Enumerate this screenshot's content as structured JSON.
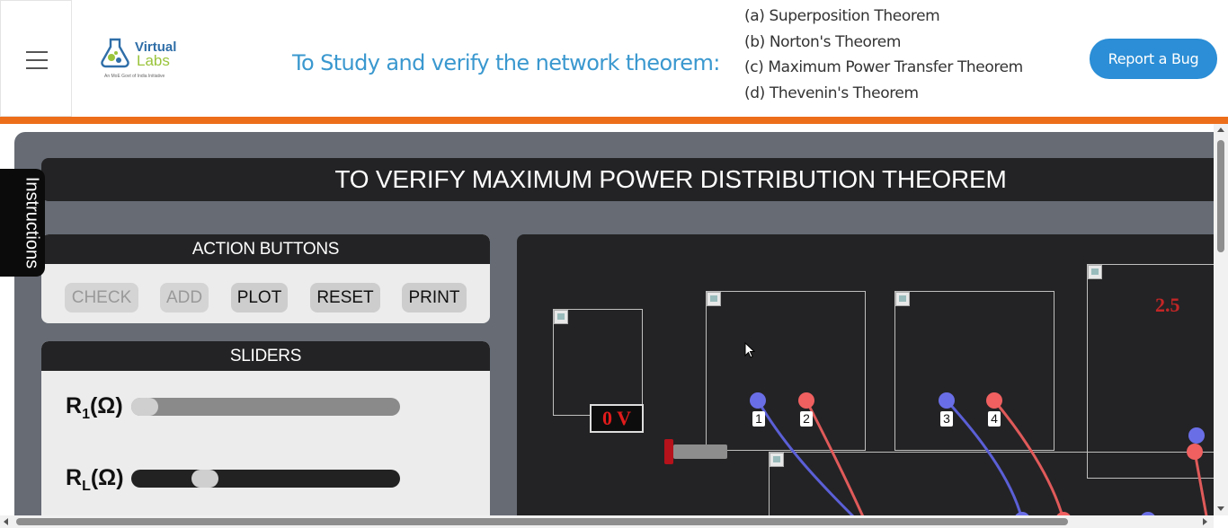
{
  "header": {
    "logo": {
      "word1": "Virtual",
      "word2": "Labs",
      "tagline": "An MoE Govt of India Initiative"
    },
    "title": "To Study and verify the network theorem:",
    "theorems": [
      "(a) Superposition Theorem",
      "(b) Norton's Theorem",
      "(c) Maximum Power Transfer Theorem",
      "(d) Thevenin's Theorem"
    ],
    "report_bug": "Report a Bug"
  },
  "sidebar_tab": {
    "label": "Instructions"
  },
  "simulation": {
    "title": "TO VERIFY MAXIMUM POWER DISTRIBUTION THEOREM",
    "action_panel": {
      "heading": "ACTION BUTTONS",
      "buttons": [
        {
          "label": "CHECK",
          "enabled": false
        },
        {
          "label": "ADD",
          "enabled": false
        },
        {
          "label": "PLOT",
          "enabled": true
        },
        {
          "label": "RESET",
          "enabled": true
        },
        {
          "label": "PRINT",
          "enabled": true
        }
      ]
    },
    "sliders_panel": {
      "heading": "SLIDERS",
      "sliders": [
        {
          "label_main": "R",
          "label_sub": "1",
          "label_unit": "(Ω)",
          "level": 0.0
        },
        {
          "label_main": "R",
          "label_sub": "L",
          "label_unit": "(Ω)",
          "level": 0.25
        }
      ]
    },
    "circuit": {
      "voltmeter_reading": "0 V",
      "meter_reading": "2.5",
      "terminals": [
        "1",
        "2",
        "3",
        "4"
      ]
    }
  },
  "colors": {
    "accent_blue": "#2b8ed6",
    "title_blue": "#3a98cf",
    "orange_bar": "#ed6e1a",
    "panel_dark": "#232325",
    "wire_blue": "#5b5fd6",
    "wire_red": "#e05a5a"
  }
}
